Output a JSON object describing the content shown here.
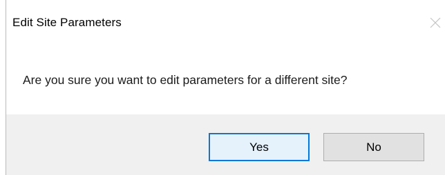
{
  "dialog": {
    "title": "Edit Site Parameters",
    "message": "Are you sure you want to edit parameters for a different site?",
    "buttons": {
      "yes_label": "Yes",
      "no_label": "No"
    },
    "close_icon": "close-icon"
  },
  "colors": {
    "default_button_border": "#0078d7",
    "footer_background": "#f0f0f0"
  }
}
